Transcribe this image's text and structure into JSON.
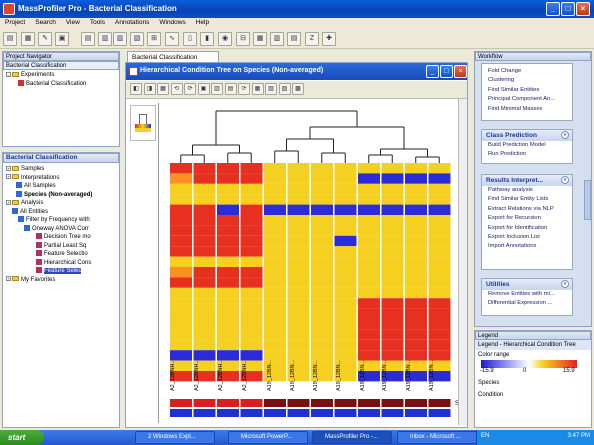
{
  "window": {
    "title": "MassProfiler Pro - Bacterial Classification"
  },
  "menu": [
    "Project",
    "Search",
    "View",
    "Tools",
    "Annotations",
    "Windows",
    "Help"
  ],
  "navigator": {
    "title": "Project Navigator",
    "subtitle": "Bacterial Classification",
    "experiments_label": "Experiments",
    "experiment_item": "Bacterial Classification"
  },
  "experiment": {
    "title": "Bacterial Classification",
    "items": [
      "Samples",
      "Interpretations",
      "All Samples",
      "Species (Non-averaged)",
      "Analysis",
      "All Entities",
      "Filter by Frequency with",
      "Oneway ANOVA Corr",
      "Decision Tree mo",
      "Partial Least Sq",
      "Feature Selectio",
      "Hierarchical Cons",
      "Feature Selec",
      "My Favorites"
    ]
  },
  "tabs": {
    "main": "Bacterial Classification"
  },
  "hc": {
    "title": "Hierarchical Condition Tree on Species (Non-averaged)",
    "col_labels": [
      "A2_12BNH...",
      "A2_12BNH...",
      "A2_12BNH...",
      "A2_12BNH...",
      "A19_12BN...",
      "A19_12BN...",
      "A19_12BN...",
      "A19_12BN...",
      "A19_12BN...",
      "A19_12BN...",
      "A19_12BN...",
      "A19_12BN..."
    ],
    "species_marker": "S..."
  },
  "workflow": {
    "title": "Workflow",
    "sec1": [
      "Fold Change",
      "Clustering",
      "Find Similar Entities",
      "Principal Component An...",
      "Find Minimal Masses"
    ],
    "class_prediction": {
      "title": "Class Prediction",
      "items": [
        "Build Prediction Model",
        "Run Prediction"
      ]
    },
    "results": {
      "title": "Results Interpret...",
      "items": [
        "Pathway analysis",
        "Find Similar Entity Lists",
        "Extract Relations via NLP",
        "Export for Recursion",
        "Export for Identification",
        "Export Inclusion List",
        "Import Annotations"
      ]
    },
    "utilities": {
      "title": "Utilities",
      "items": [
        "Remove Entities with mi...",
        "Differential Expression ..."
      ]
    }
  },
  "legend": {
    "title": "Legend",
    "header": "Legend - Hierarchical Condition Tree",
    "color_range": "Color range",
    "min": "-15.9",
    "mid": "0",
    "max": "15.9",
    "species": "Species",
    "condition": "Condition"
  },
  "taskbar": {
    "start": "start",
    "tasks": [
      "2 Windows Expl...",
      "Microsoft PowerP...",
      "MassProfiler Pro -...",
      "Inbox - Microsoft ...",
      "Document1 - Micr..."
    ],
    "lang": "EN",
    "time": "3:47 PM"
  },
  "heat": {
    "colors": [
      "#2b2bd8",
      "#e83020",
      "#f5d020",
      "#ff8f20"
    ]
  }
}
